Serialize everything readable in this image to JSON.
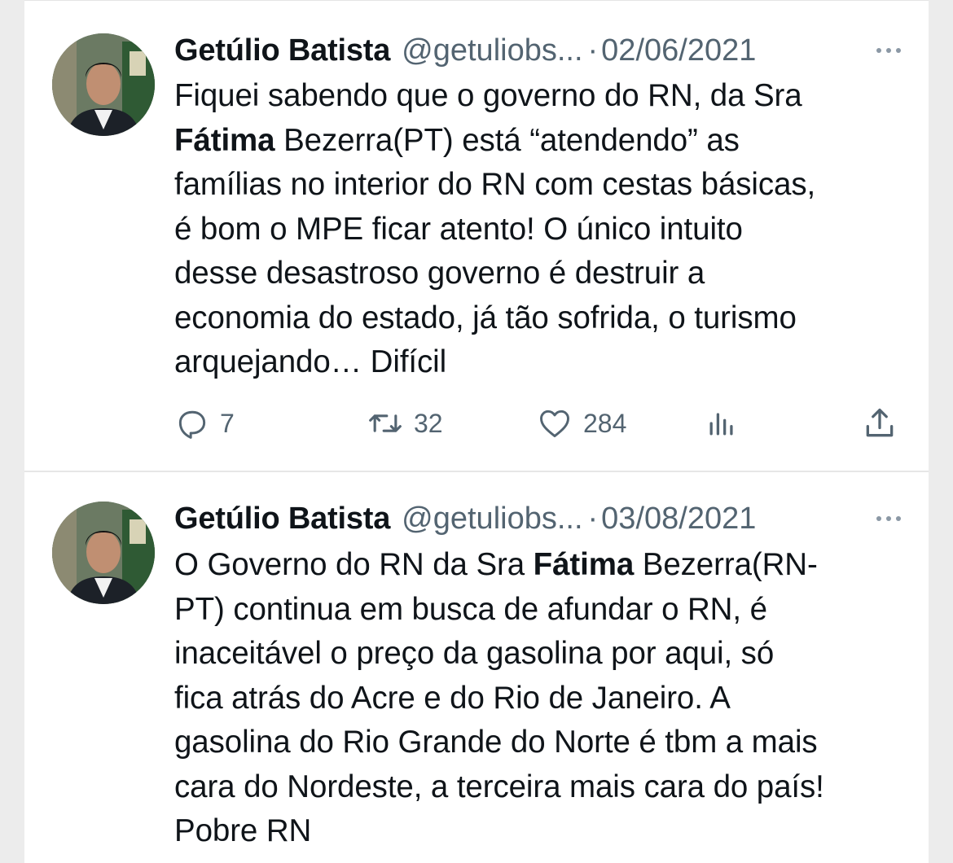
{
  "tweets": [
    {
      "author": "Getúlio Batista",
      "handle": "@getuliobs...",
      "separator": "·",
      "date": "02/06/2021",
      "lines": [
        [
          "Fiquei sabendo que o governo do RN, da Sra"
        ],
        [
          "",
          "Fátima",
          " Bezerra(PT) está “atendendo” as"
        ],
        [
          "famílias no interior do RN com cestas básicas,"
        ],
        [
          "é bom o MPE ficar atento! O único intuito"
        ],
        [
          "desse desastroso governo é destruir a"
        ],
        [
          "economia do estado, já tão sofrida, o turismo"
        ],
        [
          "arquejando… Difícil"
        ]
      ],
      "replies": "7",
      "retweets": "32",
      "likes": "284"
    },
    {
      "author": "Getúlio Batista",
      "handle": "@getuliobs...",
      "separator": "·",
      "date": "03/08/2021",
      "lines": [
        [
          "O Governo do RN da Sra ",
          "Fátima",
          " Bezerra(RN-"
        ],
        [
          "PT) continua em busca de afundar o RN, é"
        ],
        [
          "inaceitável o preço da gasolina por aqui, só"
        ],
        [
          "fica atrás do Acre e do Rio de Janeiro. A"
        ],
        [
          "gasolina do Rio Grande do Norte é tbm a mais"
        ],
        [
          "cara do Nordeste, a terceira mais cara do país!"
        ],
        [
          "Pobre RN"
        ]
      ]
    }
  ],
  "icons": {
    "reply": "reply-icon",
    "retweet": "retweet-icon",
    "like": "heart-icon",
    "views": "views-icon",
    "share": "share-icon",
    "more": "more-icon"
  },
  "colors": {
    "text": "#0f1419",
    "muted": "#536471",
    "background": "#ffffff"
  }
}
